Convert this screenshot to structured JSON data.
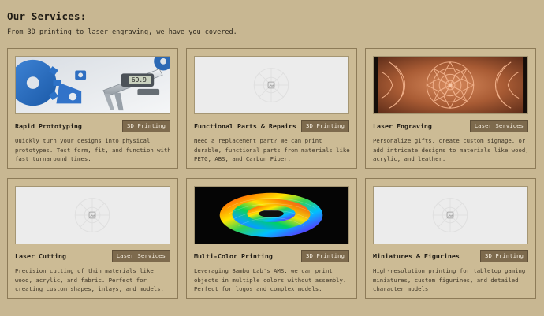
{
  "header": {
    "title": "Our Services:",
    "subtitle": "From 3D printing to laser engraving, we have you covered."
  },
  "colors": {
    "page_bg": "#c8b792",
    "card_border": "#8d7b58",
    "tag_bg": "#7d6a4d",
    "tag_text": "#f2eadb"
  },
  "cards": [
    {
      "title": "Rapid Prototyping",
      "tag": "3D Printing",
      "description": "Quickly turn your designs into physical prototypes. Test form, fit, and function with fast turnaround times.",
      "image": "photo-3d-printed-gears-caliper"
    },
    {
      "title": "Functional Parts & Repairs",
      "tag": "3D Printing",
      "description": "Need a replacement part? We can print durable, functional parts from materials like PETG, ABS, and Carbon Fiber.",
      "image": "image-placeholder-icon"
    },
    {
      "title": "Laser Engraving",
      "tag": "Laser Services",
      "description": "Personalize gifts, create custom signage, or add intricate designs to materials like wood, acrylic, and leather.",
      "image": "photo-engraved-wood-mandala"
    },
    {
      "title": "Laser Cutting",
      "tag": "Laser Services",
      "description": "Precision cutting of thin materials like wood, acrylic, and fabric. Perfect for creating custom shapes, inlays, and models.",
      "image": "image-placeholder-icon"
    },
    {
      "title": "Multi-Color Printing",
      "tag": "3D Printing",
      "description": "Leveraging Bambu Lab's AMS, we can print objects in multiple colors without assembly. Perfect for logos and complex models.",
      "image": "photo-rainbow-spiral-print"
    },
    {
      "title": "Miniatures & Figurines",
      "tag": "3D Printing",
      "description": "High-resolution printing for tabletop gaming miniatures, custom figurines, and detailed character models.",
      "image": "image-placeholder-icon"
    }
  ]
}
